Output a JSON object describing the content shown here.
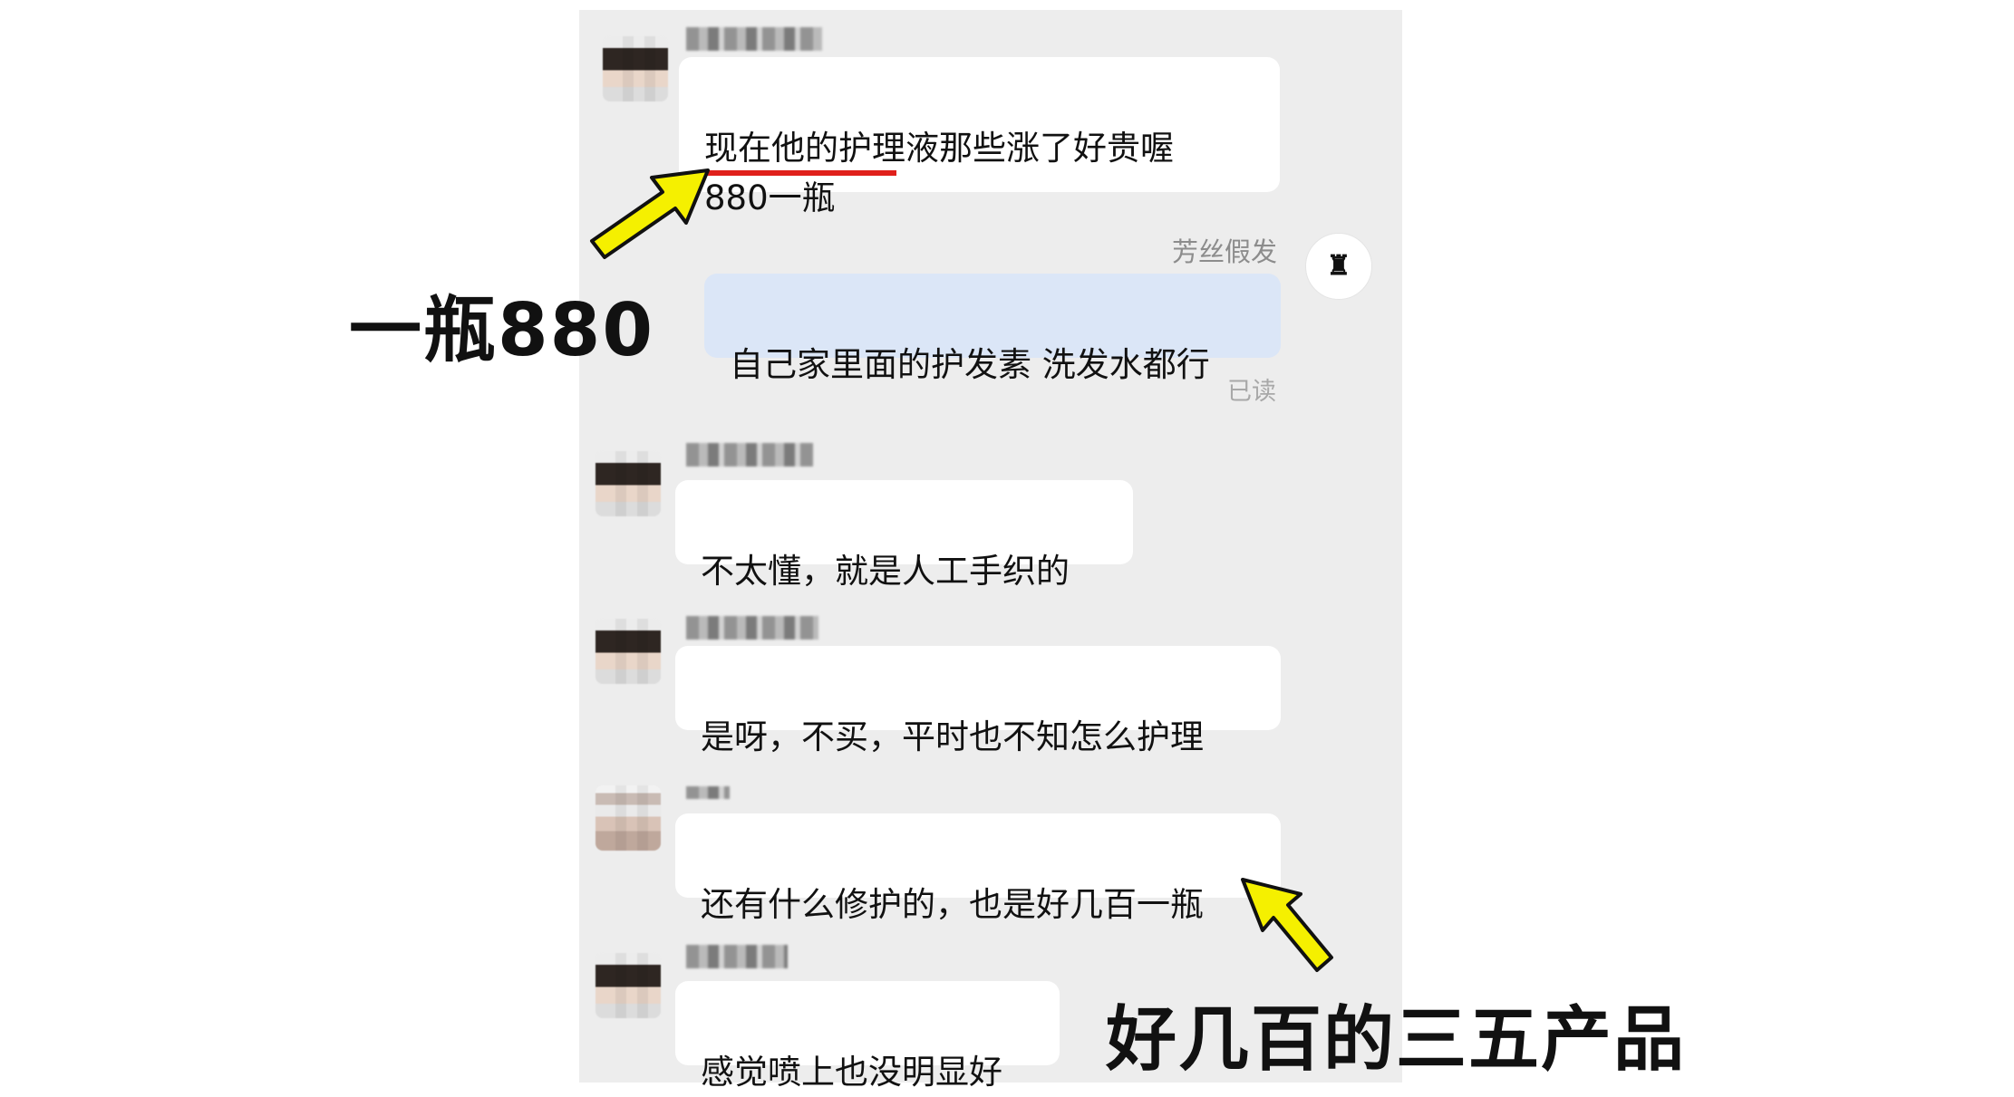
{
  "messages": [
    {
      "text": "现在他的护理液那些涨了好贵喔\n880一瓶"
    },
    {
      "sender": "芳丝假发",
      "text": "自己家里面的护发素 洗发水都行",
      "status": "已读"
    },
    {
      "text": "不太懂，就是人工手织的"
    },
    {
      "text": "是呀，不买，平时也不知怎么护理"
    },
    {
      "text": "还有什么修护的，也是好几百一瓶"
    },
    {
      "text": "感觉喷上也没明显好"
    }
  ],
  "annotations": {
    "left_caption": "一瓶880",
    "bottom_caption": "好几百的三五产品"
  },
  "colors": {
    "panel_bg": "#ededed",
    "bubble_other": "#ffffff",
    "bubble_self": "#dbe6f7",
    "highlight_underline": "#e0201b",
    "arrow_fill": "#f5f000"
  },
  "icons": {
    "arrow": "yellow-arrow-icon",
    "shop_avatar": "shop-logo-icon"
  }
}
